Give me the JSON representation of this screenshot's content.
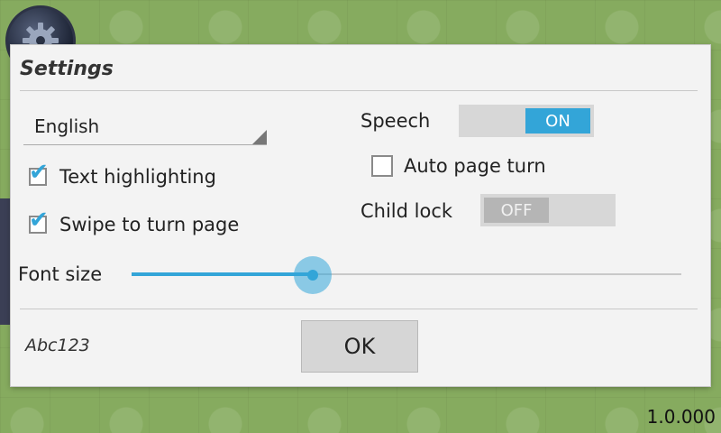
{
  "dialog": {
    "title": "Settings",
    "language": {
      "selected": "English"
    },
    "checkboxes": [
      {
        "label": "Text highlighting",
        "checked": true
      },
      {
        "label": "Swipe to turn page",
        "checked": true
      }
    ],
    "speech": {
      "label": "Speech",
      "state": "ON"
    },
    "auto_page_turn": {
      "label": "Auto page turn",
      "checked": false
    },
    "child_lock": {
      "label": "Child lock",
      "state": "OFF"
    },
    "font_size": {
      "label": "Font size",
      "level": 0.33
    },
    "sample_text": "Abc123",
    "ok_label": "OK"
  },
  "background": {
    "settings_icon": "gear-icon",
    "version": "1.0.000"
  },
  "colors": {
    "accent": "#33a5d8",
    "dialog_bg": "#f3f3f3",
    "background_green": "#86ab5f"
  }
}
